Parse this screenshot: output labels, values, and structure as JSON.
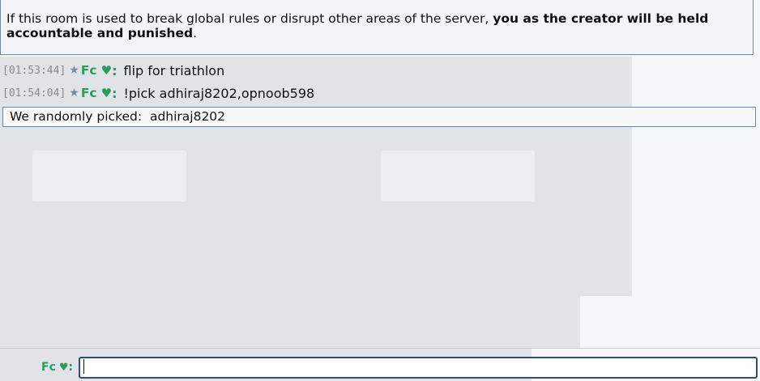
{
  "notice": {
    "text_normal": "If this room is used to break global rules or disrupt other areas of the server, ",
    "text_bold": "you as the creator will be held accountable and punished",
    "text_end": "."
  },
  "messages": [
    {
      "timestamp": "[01:53:44]",
      "rank_symbol": "★",
      "username": "Fc",
      "heart": "♥",
      "colon": ":",
      "text": "flip for triathlon"
    },
    {
      "timestamp": "[01:54:04]",
      "rank_symbol": "★",
      "username": "Fc",
      "heart": "♥",
      "colon": ":",
      "text": "!pick adhiraj8202,opnoob598"
    }
  ],
  "result": {
    "text": "We randomly picked:  adhiraj8202"
  },
  "compose": {
    "username": "Fc",
    "heart": "♥",
    "colon": ":",
    "value": "",
    "placeholder": ""
  },
  "colors": {
    "username_green": "#2a9b62",
    "border_blue": "#6a89a8",
    "input_border": "#2b4f7a"
  }
}
